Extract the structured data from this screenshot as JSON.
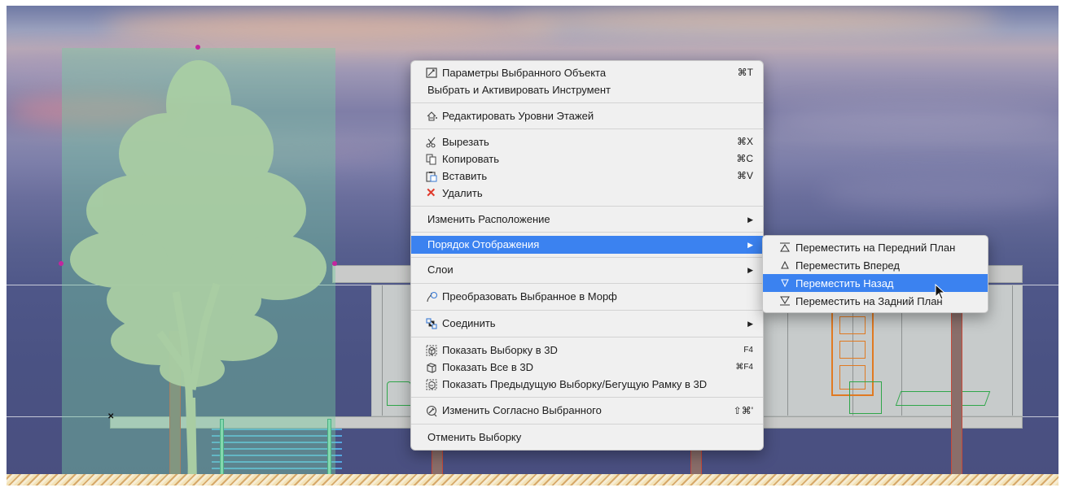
{
  "context_menu": {
    "items": [
      {
        "label": "Параметры Выбранного Объекта",
        "shortcut": "⌘T",
        "icon": "object-settings-icon"
      },
      {
        "label": "Выбрать и Активировать Инструмент"
      },
      {
        "label": "Редактировать Уровни Этажей",
        "icon": "story-levels-icon"
      },
      {
        "label": "Вырезать",
        "shortcut": "⌘X",
        "icon": "scissors-icon"
      },
      {
        "label": "Копировать",
        "shortcut": "⌘C",
        "icon": "copy-icon"
      },
      {
        "label": "Вставить",
        "shortcut": "⌘V",
        "icon": "paste-icon"
      },
      {
        "label": "Удалить",
        "icon": "delete-icon"
      },
      {
        "label": "Изменить Расположение",
        "submenu": true
      },
      {
        "label": "Порядок Отображения",
        "submenu": true,
        "active": true
      },
      {
        "label": "Слои",
        "submenu": true
      },
      {
        "label": "Преобразовать Выбранное в Морф",
        "icon": "morph-icon"
      },
      {
        "label": "Соединить",
        "submenu": true,
        "icon": "connect-icon"
      },
      {
        "label": "Показать Выборку в 3D",
        "shortcut": "F4",
        "icon": "show-selection-3d-icon"
      },
      {
        "label": "Показать Все в 3D",
        "shortcut": "⌘F4",
        "icon": "show-all-3d-icon"
      },
      {
        "label": "Показать Предыдущую Выборку/Бегущую Рамку в 3D",
        "icon": "show-previous-3d-icon"
      },
      {
        "label": "Изменить Согласно Выбранного",
        "shortcut": "⇧⌘'",
        "icon": "eyedropper-icon"
      },
      {
        "label": "Отменить Выборку"
      }
    ]
  },
  "submenu": {
    "items": [
      {
        "label": "Переместить на Передний План",
        "icon": "bring-to-front-icon"
      },
      {
        "label": "Переместить Вперед",
        "icon": "bring-forward-icon"
      },
      {
        "label": "Переместить Назад",
        "icon": "send-backward-icon",
        "active": true
      },
      {
        "label": "Переместить на Задний План",
        "icon": "send-to-back-icon"
      }
    ]
  },
  "colors": {
    "highlight": "#3b82f0",
    "menu_bg": "#f0f0f0",
    "selection_handle": "#c4259e",
    "tree_fill": "#a6c9a0"
  }
}
